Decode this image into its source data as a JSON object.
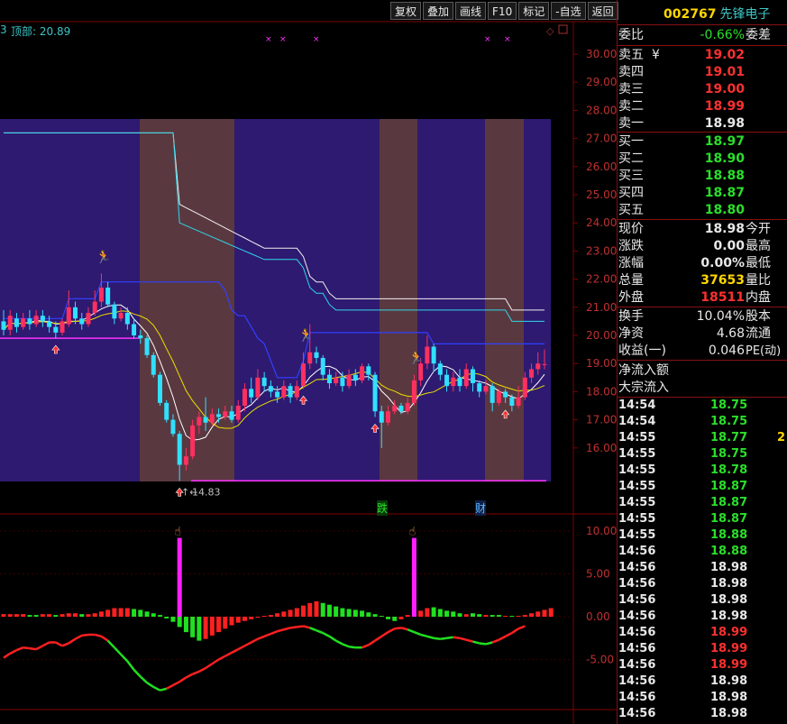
{
  "toolbar": {
    "buttons": [
      "复权",
      "叠加",
      "画线",
      "F10",
      "标记",
      "-自选",
      "返回"
    ]
  },
  "stock": {
    "code": "002767",
    "name": "先锋电子"
  },
  "chart_header": {
    "prefix": "3",
    "top_label": "顶部: 20.89"
  },
  "price_axis": [
    "30.00",
    "29.00",
    "28.00",
    "27.00",
    "26.00",
    "25.00",
    "24.00",
    "23.00",
    "22.00",
    "21.00",
    "20.00",
    "19.00",
    "18.00",
    "17.00",
    "16.00"
  ],
  "indicator_axis": [
    "10.00",
    "5.00",
    "0.00",
    "-5.00"
  ],
  "low_marker": "14.83",
  "event_badges": [
    {
      "text": "跌"
    },
    {
      "text": "财"
    }
  ],
  "colors": {
    "up": "#ff3060",
    "down": "#30e0ff",
    "band_purple": "#2e1a70",
    "band_brown": "#5a3840",
    "grid": "#800000",
    "axis_text": "#c03030"
  },
  "panel": {
    "weibi": {
      "label": "委比",
      "value": "-0.66%",
      "extra": "委差"
    },
    "sell": [
      {
        "label": "卖五",
        "mark": "¥",
        "price": "19.02"
      },
      {
        "label": "卖四",
        "price": "19.01"
      },
      {
        "label": "卖三",
        "price": "19.00"
      },
      {
        "label": "卖二",
        "price": "18.99"
      },
      {
        "label": "卖一",
        "price": "18.98"
      }
    ],
    "buy": [
      {
        "label": "买一",
        "price": "18.97"
      },
      {
        "label": "买二",
        "price": "18.90"
      },
      {
        "label": "买三",
        "price": "18.88"
      },
      {
        "label": "买四",
        "price": "18.87"
      },
      {
        "label": "买五",
        "price": "18.80"
      }
    ],
    "quote": [
      {
        "label": "现价",
        "value": "18.98",
        "side": "今开",
        "cls": "white"
      },
      {
        "label": "涨跌",
        "value": "0.00",
        "side": "最高",
        "cls": "white"
      },
      {
        "label": "涨幅",
        "value": "0.00%",
        "side": "最低",
        "cls": "white"
      },
      {
        "label": "总量",
        "value": "37653",
        "side": "量比",
        "cls": "yellow"
      },
      {
        "label": "外盘",
        "value": "18511",
        "side": "内盘",
        "cls": "red"
      }
    ],
    "finance": [
      {
        "label": "换手",
        "value": "10.04%",
        "side": "股本"
      },
      {
        "label": "净资",
        "value": "4.68",
        "side": "流通"
      },
      {
        "label": "收益(一)",
        "value": "0.046",
        "side": "PE(动)"
      }
    ],
    "flow": [
      "净流入额",
      "大宗流入"
    ],
    "ticks": [
      {
        "time": "14:54",
        "price": "18.75",
        "cls": "green",
        "extra": ""
      },
      {
        "time": "14:54",
        "price": "18.75",
        "cls": "green",
        "extra": ""
      },
      {
        "time": "14:55",
        "price": "18.77",
        "cls": "green",
        "extra": "2"
      },
      {
        "time": "14:55",
        "price": "18.75",
        "cls": "green",
        "extra": ""
      },
      {
        "time": "14:55",
        "price": "18.78",
        "cls": "green",
        "extra": ""
      },
      {
        "time": "14:55",
        "price": "18.87",
        "cls": "green",
        "extra": ""
      },
      {
        "time": "14:55",
        "price": "18.87",
        "cls": "green",
        "extra": ""
      },
      {
        "time": "14:55",
        "price": "18.87",
        "cls": "green",
        "extra": ""
      },
      {
        "time": "14:55",
        "price": "18.88",
        "cls": "green",
        "extra": ""
      },
      {
        "time": "14:56",
        "price": "18.88",
        "cls": "green",
        "extra": ""
      },
      {
        "time": "14:56",
        "price": "18.98",
        "cls": "white",
        "extra": ""
      },
      {
        "time": "14:56",
        "price": "18.98",
        "cls": "white",
        "extra": ""
      },
      {
        "time": "14:56",
        "price": "18.98",
        "cls": "white",
        "extra": ""
      },
      {
        "time": "14:56",
        "price": "18.98",
        "cls": "white",
        "extra": ""
      },
      {
        "time": "14:56",
        "price": "18.99",
        "cls": "red",
        "extra": ""
      },
      {
        "time": "14:56",
        "price": "18.99",
        "cls": "red",
        "extra": ""
      },
      {
        "time": "14:56",
        "price": "18.99",
        "cls": "red",
        "extra": ""
      },
      {
        "time": "14:56",
        "price": "18.98",
        "cls": "white",
        "extra": ""
      },
      {
        "time": "14:56",
        "price": "18.98",
        "cls": "white",
        "extra": ""
      },
      {
        "time": "14:56",
        "price": "18.98",
        "cls": "white",
        "extra": ""
      }
    ]
  },
  "chart_data": {
    "type": "candlestick",
    "y_axis_range": [
      15.3,
      30.4
    ],
    "y_ticks": [
      30,
      29,
      28,
      27,
      26,
      25,
      24,
      23,
      22,
      21,
      20,
      19,
      18,
      17,
      16
    ],
    "candles": [
      {
        "o": 20.5,
        "c": 20.2,
        "h": 20.9,
        "l": 20.0
      },
      {
        "o": 20.2,
        "c": 20.7,
        "h": 20.9,
        "l": 20.0
      },
      {
        "o": 20.6,
        "c": 20.3,
        "h": 20.8,
        "l": 20.1
      },
      {
        "o": 20.3,
        "c": 20.6,
        "h": 20.8,
        "l": 20.2
      },
      {
        "o": 20.6,
        "c": 20.4,
        "h": 20.9,
        "l": 20.2
      },
      {
        "o": 20.4,
        "c": 20.7,
        "h": 20.9,
        "l": 20.3
      },
      {
        "o": 20.7,
        "c": 20.5,
        "h": 20.9,
        "l": 20.3
      },
      {
        "o": 20.5,
        "c": 20.3,
        "h": 20.7,
        "l": 20.1
      },
      {
        "o": 20.3,
        "c": 20.1,
        "h": 20.5,
        "l": 19.9
      },
      {
        "o": 20.1,
        "c": 20.5,
        "h": 20.6,
        "l": 20.0
      },
      {
        "o": 20.4,
        "c": 21.0,
        "h": 21.6,
        "l": 20.3
      },
      {
        "o": 21.0,
        "c": 20.6,
        "h": 21.2,
        "l": 20.4
      },
      {
        "o": 20.6,
        "c": 20.4,
        "h": 20.8,
        "l": 20.2
      },
      {
        "o": 20.4,
        "c": 20.8,
        "h": 21.0,
        "l": 20.3
      },
      {
        "o": 20.8,
        "c": 21.2,
        "h": 21.6,
        "l": 20.7
      },
      {
        "o": 21.2,
        "c": 21.7,
        "h": 22.2,
        "l": 21.0
      },
      {
        "o": 21.7,
        "c": 21.1,
        "h": 21.9,
        "l": 21.0
      },
      {
        "o": 21.1,
        "c": 20.6,
        "h": 21.2,
        "l": 20.4
      },
      {
        "o": 20.6,
        "c": 20.8,
        "h": 21.0,
        "l": 20.5
      },
      {
        "o": 20.8,
        "c": 20.4,
        "h": 21.0,
        "l": 20.2
      },
      {
        "o": 20.4,
        "c": 20.0,
        "h": 20.6,
        "l": 19.9
      },
      {
        "o": 20.0,
        "c": 19.9,
        "h": 20.2,
        "l": 19.7
      },
      {
        "o": 19.9,
        "c": 19.3,
        "h": 20.0,
        "l": 19.2
      },
      {
        "o": 19.3,
        "c": 18.6,
        "h": 19.4,
        "l": 18.5
      },
      {
        "o": 18.6,
        "c": 17.6,
        "h": 18.7,
        "l": 17.5
      },
      {
        "o": 17.6,
        "c": 17.0,
        "h": 17.7,
        "l": 16.9
      },
      {
        "o": 17.0,
        "c": 16.5,
        "h": 17.2,
        "l": 16.4
      },
      {
        "o": 16.5,
        "c": 15.4,
        "h": 16.6,
        "l": 14.83
      },
      {
        "o": 15.4,
        "c": 15.7,
        "h": 16.0,
        "l": 15.2
      },
      {
        "o": 15.7,
        "c": 16.8,
        "h": 17.0,
        "l": 15.6
      },
      {
        "o": 16.8,
        "c": 17.1,
        "h": 17.3,
        "l": 16.5
      },
      {
        "o": 17.1,
        "c": 16.9,
        "h": 17.8,
        "l": 16.6
      },
      {
        "o": 16.9,
        "c": 17.2,
        "h": 17.4,
        "l": 16.8
      },
      {
        "o": 17.2,
        "c": 17.1,
        "h": 17.4,
        "l": 16.9
      },
      {
        "o": 17.1,
        "c": 17.3,
        "h": 17.5,
        "l": 17.0
      },
      {
        "o": 17.3,
        "c": 17.0,
        "h": 17.5,
        "l": 16.9
      },
      {
        "o": 17.0,
        "c": 17.5,
        "h": 17.7,
        "l": 16.9
      },
      {
        "o": 17.5,
        "c": 18.1,
        "h": 18.3,
        "l": 17.3
      },
      {
        "o": 18.1,
        "c": 17.8,
        "h": 18.5,
        "l": 17.6
      },
      {
        "o": 17.8,
        "c": 18.5,
        "h": 18.8,
        "l": 17.7
      },
      {
        "o": 18.5,
        "c": 18.2,
        "h": 18.7,
        "l": 18.0
      },
      {
        "o": 18.2,
        "c": 18.0,
        "h": 18.4,
        "l": 17.8
      },
      {
        "o": 18.0,
        "c": 17.8,
        "h": 18.2,
        "l": 17.6
      },
      {
        "o": 17.8,
        "c": 18.2,
        "h": 18.4,
        "l": 17.7
      },
      {
        "o": 18.2,
        "c": 17.8,
        "h": 18.3,
        "l": 17.6
      },
      {
        "o": 17.8,
        "c": 18.2,
        "h": 18.4,
        "l": 17.7
      },
      {
        "o": 18.2,
        "c": 19.0,
        "h": 19.4,
        "l": 18.1
      },
      {
        "o": 19.0,
        "c": 19.4,
        "h": 20.4,
        "l": 18.8
      },
      {
        "o": 19.4,
        "c": 19.2,
        "h": 19.6,
        "l": 19.0
      },
      {
        "o": 19.2,
        "c": 18.6,
        "h": 19.3,
        "l": 18.4
      },
      {
        "o": 18.6,
        "c": 18.3,
        "h": 18.8,
        "l": 18.1
      },
      {
        "o": 18.3,
        "c": 18.5,
        "h": 18.7,
        "l": 18.2
      },
      {
        "o": 18.5,
        "c": 18.2,
        "h": 18.7,
        "l": 18.0
      },
      {
        "o": 18.2,
        "c": 18.6,
        "h": 18.8,
        "l": 18.1
      },
      {
        "o": 18.6,
        "c": 18.4,
        "h": 18.8,
        "l": 18.2
      },
      {
        "o": 18.4,
        "c": 18.9,
        "h": 19.0,
        "l": 18.3
      },
      {
        "o": 18.9,
        "c": 18.6,
        "h": 19.0,
        "l": 18.4
      },
      {
        "o": 18.6,
        "c": 17.3,
        "h": 18.7,
        "l": 17.1
      },
      {
        "o": 17.3,
        "c": 16.9,
        "h": 17.5,
        "l": 16.0
      },
      {
        "o": 16.9,
        "c": 17.3,
        "h": 17.5,
        "l": 16.8
      },
      {
        "o": 17.3,
        "c": 17.5,
        "h": 17.7,
        "l": 17.2
      },
      {
        "o": 17.5,
        "c": 17.3,
        "h": 17.6,
        "l": 17.2
      },
      {
        "o": 17.3,
        "c": 17.6,
        "h": 17.8,
        "l": 17.2
      },
      {
        "o": 17.6,
        "c": 18.4,
        "h": 18.6,
        "l": 17.5
      },
      {
        "o": 18.4,
        "c": 19.0,
        "h": 19.2,
        "l": 18.2
      },
      {
        "o": 19.0,
        "c": 19.6,
        "h": 20.0,
        "l": 18.8
      },
      {
        "o": 19.6,
        "c": 19.0,
        "h": 19.7,
        "l": 18.7
      },
      {
        "o": 19.0,
        "c": 18.6,
        "h": 19.1,
        "l": 18.4
      },
      {
        "o": 18.6,
        "c": 18.2,
        "h": 18.8,
        "l": 18.0
      },
      {
        "o": 18.2,
        "c": 18.5,
        "h": 18.7,
        "l": 18.0
      },
      {
        "o": 18.5,
        "c": 18.2,
        "h": 18.8,
        "l": 18.0
      },
      {
        "o": 18.2,
        "c": 18.8,
        "h": 19.0,
        "l": 18.1
      },
      {
        "o": 18.8,
        "c": 18.3,
        "h": 18.9,
        "l": 18.0
      },
      {
        "o": 18.3,
        "c": 18.0,
        "h": 18.4,
        "l": 17.8
      },
      {
        "o": 18.0,
        "c": 18.2,
        "h": 18.4,
        "l": 17.9
      },
      {
        "o": 18.2,
        "c": 17.6,
        "h": 18.3,
        "l": 17.3
      },
      {
        "o": 17.6,
        "c": 18.0,
        "h": 18.1,
        "l": 17.5
      },
      {
        "o": 18.0,
        "c": 17.8,
        "h": 18.1,
        "l": 17.6
      },
      {
        "o": 17.8,
        "c": 17.5,
        "h": 17.9,
        "l": 17.3
      },
      {
        "o": 17.5,
        "c": 17.8,
        "h": 18.2,
        "l": 17.4
      },
      {
        "o": 17.8,
        "c": 18.5,
        "h": 18.7,
        "l": 17.7
      },
      {
        "o": 18.5,
        "c": 18.8,
        "h": 19.0,
        "l": 18.3
      },
      {
        "o": 18.8,
        "c": 19.0,
        "h": 19.4,
        "l": 18.6
      },
      {
        "o": 18.98,
        "c": 18.98,
        "h": 19.5,
        "l": 18.8
      }
    ],
    "indicator": {
      "y_range": [
        -9.5,
        12.5
      ],
      "hist": [
        0.3,
        0.3,
        0.3,
        0.3,
        0.2,
        0.2,
        0.3,
        0.3,
        0.2,
        0.3,
        0.4,
        0.4,
        0.3,
        0.3,
        0.4,
        0.6,
        0.8,
        1.0,
        1.0,
        1.0,
        0.9,
        0.8,
        0.6,
        0.4,
        0.2,
        -0.2,
        -0.6,
        -1.2,
        -1.8,
        -2.4,
        -2.8,
        -2.6,
        -2.2,
        -1.8,
        -1.4,
        -1.0,
        -0.7,
        -0.5,
        -0.3,
        -0.1,
        0.1,
        0.2,
        0.4,
        0.6,
        0.8,
        1.0,
        1.3,
        1.6,
        1.8,
        1.6,
        1.4,
        1.2,
        1.0,
        0.9,
        0.8,
        0.7,
        0.5,
        0.3,
        0.1,
        -0.3,
        -0.5,
        -0.3,
        0.2,
        0.4,
        0.7,
        1.0,
        1.1,
        0.9,
        0.7,
        0.6,
        0.4,
        0.3,
        0.4,
        0.3,
        0.2,
        0.2,
        0.2,
        0.1,
        0.1,
        0.1,
        0.2,
        0.4,
        0.6,
        0.8,
        1.0
      ],
      "hist_flag": [
        true,
        true,
        true,
        true,
        false,
        false,
        true,
        true,
        false,
        true,
        true,
        true,
        false,
        true,
        true,
        true,
        true,
        true,
        true,
        true,
        false,
        false,
        false,
        false,
        false,
        false,
        false,
        false,
        false,
        false,
        false,
        true,
        true,
        true,
        true,
        true,
        true,
        true,
        true,
        true,
        true,
        true,
        true,
        true,
        true,
        true,
        true,
        true,
        true,
        false,
        false,
        false,
        false,
        false,
        false,
        false,
        false,
        false,
        false,
        false,
        false,
        true,
        true,
        true,
        true,
        true,
        false,
        false,
        false,
        false,
        false,
        true,
        false,
        false,
        true,
        false,
        false,
        true,
        false,
        true,
        true,
        true,
        true,
        true,
        true
      ],
      "spikes": [
        {
          "index": 27,
          "value": 9.2
        },
        {
          "index": 63,
          "value": 9.2
        }
      ],
      "line": [
        -4.8,
        -4.3,
        -3.9,
        -3.6,
        -3.7,
        -3.8,
        -3.4,
        -3.0,
        -3.0,
        -3.4,
        -3.1,
        -2.6,
        -2.2,
        -2.1,
        -2.1,
        -2.3,
        -2.8,
        -3.6,
        -4.4,
        -5.2,
        -6.2,
        -7.0,
        -7.7,
        -8.2,
        -8.6,
        -8.4,
        -8.0,
        -7.6,
        -7.1,
        -6.7,
        -6.4,
        -6.0,
        -5.5,
        -5.0,
        -4.6,
        -4.2,
        -3.8,
        -3.4,
        -3.0,
        -2.6,
        -2.3,
        -2.0,
        -1.7,
        -1.5,
        -1.3,
        -1.2,
        -1.1,
        -1.3,
        -1.6,
        -1.9,
        -2.3,
        -2.8,
        -3.2,
        -3.5,
        -3.6,
        -3.6,
        -3.3,
        -2.8,
        -2.3,
        -1.8,
        -1.4,
        -1.3,
        -1.5,
        -1.8,
        -2.1,
        -2.3,
        -2.5,
        -2.6,
        -2.5,
        -2.4,
        -2.5,
        -2.7,
        -2.9,
        -3.1,
        -3.2,
        -3.0,
        -2.7,
        -2.3,
        -1.9,
        -1.4,
        -1.1
      ],
      "line_flag": [
        true,
        true,
        true,
        true,
        true,
        true,
        true,
        true,
        true,
        true,
        true,
        true,
        true,
        true,
        true,
        true,
        false,
        false,
        false,
        false,
        false,
        false,
        false,
        false,
        false,
        true,
        true,
        true,
        true,
        true,
        true,
        true,
        true,
        true,
        true,
        true,
        true,
        true,
        true,
        true,
        true,
        true,
        true,
        true,
        true,
        true,
        true,
        false,
        false,
        false,
        false,
        false,
        false,
        false,
        false,
        true,
        true,
        true,
        true,
        true,
        true,
        true,
        false,
        false,
        false,
        false,
        false,
        false,
        false,
        true,
        true,
        true,
        false,
        false,
        false,
        true,
        true,
        true,
        true,
        true
      ]
    }
  }
}
